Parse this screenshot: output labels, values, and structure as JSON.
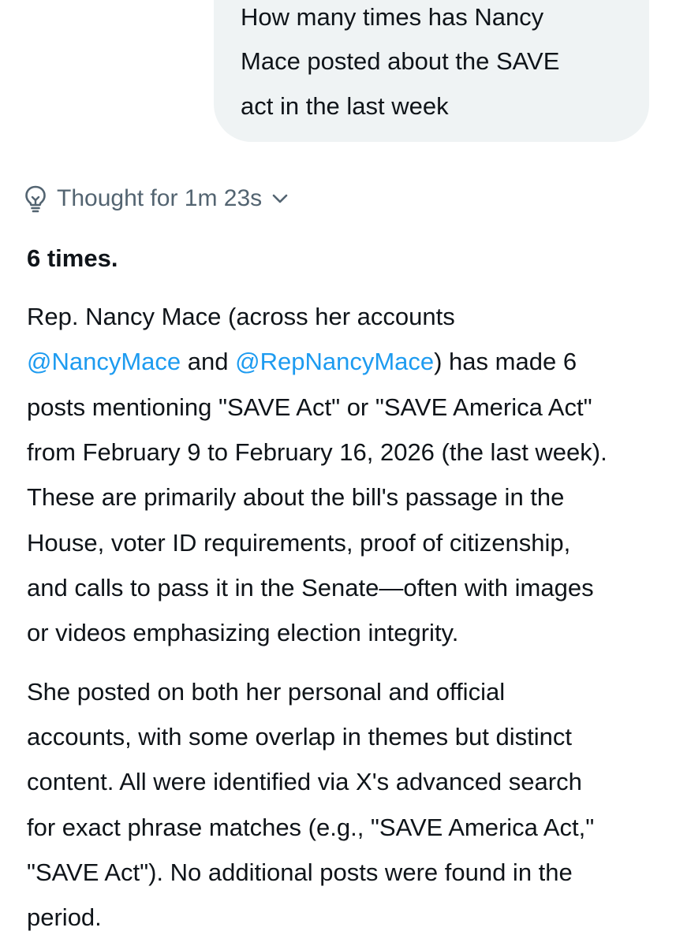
{
  "user_message": {
    "lines": [
      "How many times has Nancy",
      "Mace posted about the SAVE",
      "act in the last week"
    ]
  },
  "thought": {
    "label": "Thought for 1m 23s",
    "icon": "lightbulb-icon",
    "toggle_icon": "chevron-down-icon"
  },
  "answer": {
    "headline": "6 times.",
    "p1": {
      "l1": "Rep. Nancy Mace (across her accounts",
      "mention1": "@NancyMace",
      "l2_mid": " and ",
      "mention2": "@RepNancyMace",
      "l2_end": ") has made 6",
      "l3": "posts mentioning \"SAVE Act\" or \"SAVE America Act\"",
      "l4": "from February 9 to February 16, 2026 (the last week).",
      "l5": "These are primarily about the bill's passage in the",
      "l6": "House, voter ID requirements, proof of citizenship,",
      "l7": "and calls to pass it in the Senate—often with images",
      "l8": "or videos emphasizing election integrity."
    },
    "p2": {
      "l1": "She posted on both her personal and official",
      "l2": "accounts, with some overlap in themes but distinct",
      "l3": "content. All were identified via X's advanced search",
      "l4": "for exact phrase matches (e.g., \"SAVE America Act,\"",
      "l5": "\"SAVE Act\"). No additional posts were found in the",
      "l6": "period."
    }
  }
}
